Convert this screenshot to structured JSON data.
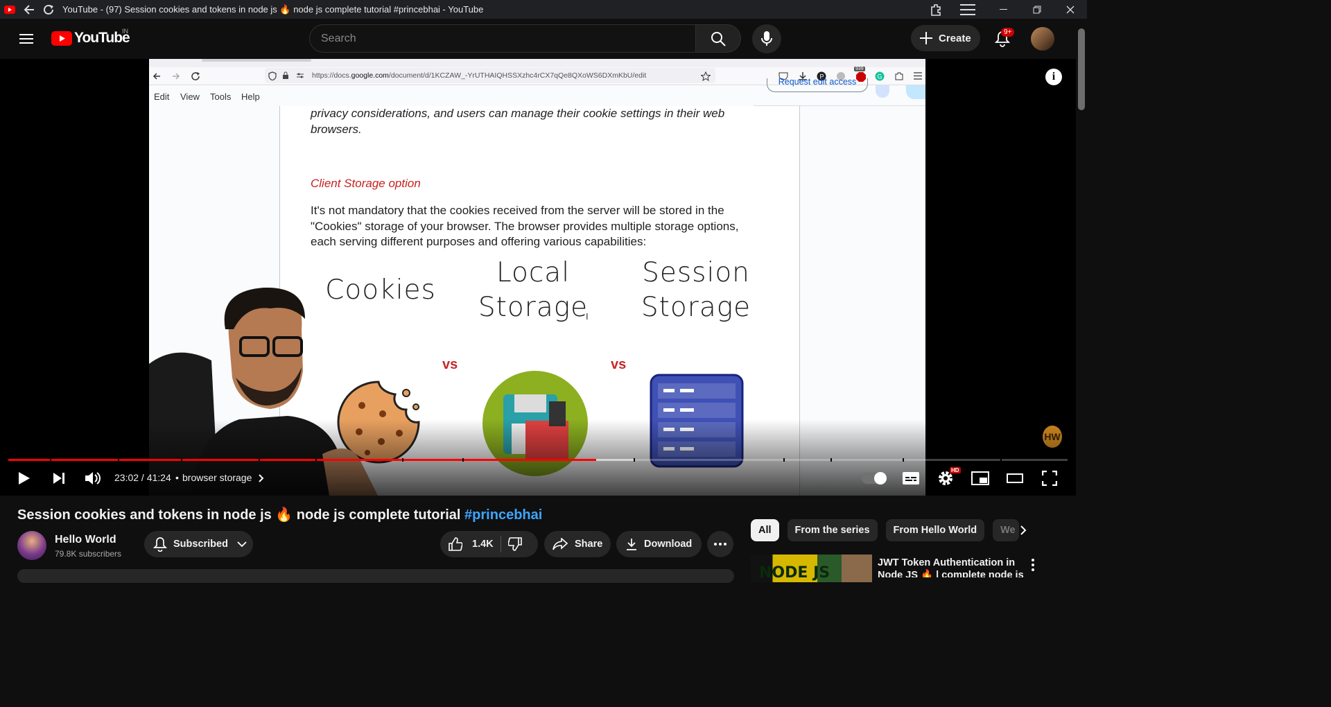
{
  "window": {
    "title": "YouTube - (97) Session cookies and tokens in node js 🔥 node js complete tutorial #princebhai - YouTube"
  },
  "header": {
    "logo_text": "YouTube",
    "country_code": "IN",
    "search_placeholder": "Search",
    "create_label": "Create",
    "notification_count": "9+"
  },
  "video_frame": {
    "browser": {
      "url_prefix": "https://docs.",
      "url_domain": "google.com",
      "url_suffix": "/document/d/1KCZAW_-YrUTHAIQHSSXzhc4rCX7qQe8QXoWS6DXmKbU/edit",
      "ext_badge": "939"
    },
    "docs_menu": [
      "Edit",
      "View",
      "Tools",
      "Help"
    ],
    "request_edit": "Request edit access",
    "doc": {
      "para1": "privacy considerations, and users can manage their cookie settings in their web browsers.",
      "heading": "Client Storage option",
      "para2": "It's not mandatory that the cookies received from the server will be stored in the \"Cookies\" storage of your browser. The browser provides multiple storage options, each serving different purposes and offering various capabilities:",
      "col1": "Cookies",
      "col2a": "Local",
      "col2b": "Storage",
      "col3a": "Session",
      "col3b": "Storage",
      "vs": "vs"
    },
    "watermark": "HW"
  },
  "player": {
    "time_current": "23:02",
    "time_total": "41:24",
    "time_display": "23:02 / 41:24",
    "chapter_sep": "•",
    "chapter": "browser storage",
    "progress_played": 0.555,
    "progress_buffered": 0.59,
    "hd_badge": "HD"
  },
  "video": {
    "title": "Session cookies and tokens in node js 🔥 node js complete tutorial ",
    "hashtag": "#princebhai",
    "channel_name": "Hello World",
    "subscribers": "79.8K subscribers",
    "subscribed_label": "Subscribed",
    "likes": "1.4K",
    "share_label": "Share",
    "download_label": "Download"
  },
  "chips": [
    "All",
    "From the series",
    "From Hello World",
    "We"
  ],
  "recommended": [
    {
      "title": "JWT Token Authentication in Node JS 🔥 | complete node js",
      "thumb_text": "NODE JS"
    }
  ],
  "colors": {
    "accent_red": "#ff0000",
    "link_blue": "#3ea6ff",
    "doc_heading_red": "#c5221f"
  }
}
